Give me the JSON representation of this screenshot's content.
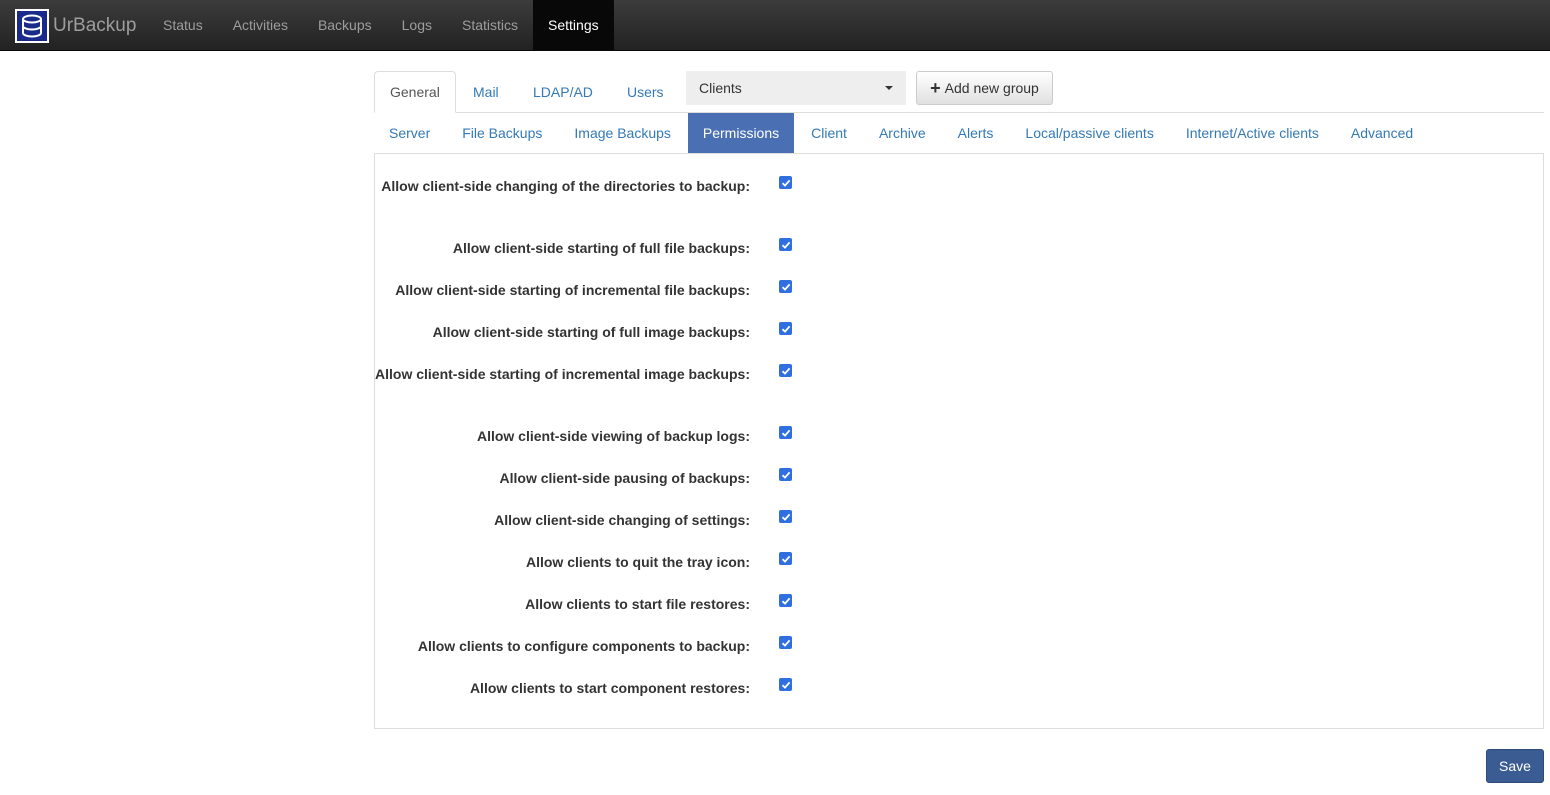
{
  "navbar": {
    "brand": "UrBackup",
    "items": [
      {
        "label": "Status",
        "active": false
      },
      {
        "label": "Activities",
        "active": false
      },
      {
        "label": "Backups",
        "active": false
      },
      {
        "label": "Logs",
        "active": false
      },
      {
        "label": "Statistics",
        "active": false
      },
      {
        "label": "Settings",
        "active": true
      }
    ]
  },
  "tabs": {
    "items": [
      {
        "label": "General",
        "active": true
      },
      {
        "label": "Mail",
        "active": false
      },
      {
        "label": "LDAP/AD",
        "active": false
      },
      {
        "label": "Users",
        "active": false
      }
    ],
    "group_select_value": "Clients",
    "add_group_label": "Add new group"
  },
  "subtabs": [
    {
      "label": "Server",
      "active": false
    },
    {
      "label": "File Backups",
      "active": false
    },
    {
      "label": "Image Backups",
      "active": false
    },
    {
      "label": "Permissions",
      "active": true
    },
    {
      "label": "Client",
      "active": false
    },
    {
      "label": "Archive",
      "active": false
    },
    {
      "label": "Alerts",
      "active": false
    },
    {
      "label": "Local/passive clients",
      "active": false
    },
    {
      "label": "Internet/Active clients",
      "active": false
    },
    {
      "label": "Advanced",
      "active": false
    }
  ],
  "permissions": [
    {
      "label": "Allow client-side changing of the directories to backup:",
      "checked": true
    },
    {
      "label": "Allow client-side starting of full file backups:",
      "checked": true
    },
    {
      "label": "Allow client-side starting of incremental file backups:",
      "checked": true
    },
    {
      "label": "Allow client-side starting of full image backups:",
      "checked": true
    },
    {
      "label": "Allow client-side starting of incremental image backups:",
      "checked": true
    },
    {
      "label": "Allow client-side viewing of backup logs:",
      "checked": true
    },
    {
      "label": "Allow client-side pausing of backups:",
      "checked": true
    },
    {
      "label": "Allow client-side changing of settings:",
      "checked": true
    },
    {
      "label": "Allow clients to quit the tray icon:",
      "checked": true
    },
    {
      "label": "Allow clients to start file restores:",
      "checked": true
    },
    {
      "label": "Allow clients to configure components to backup:",
      "checked": true
    },
    {
      "label": "Allow clients to start component restores:",
      "checked": true
    }
  ],
  "save_label": "Save"
}
